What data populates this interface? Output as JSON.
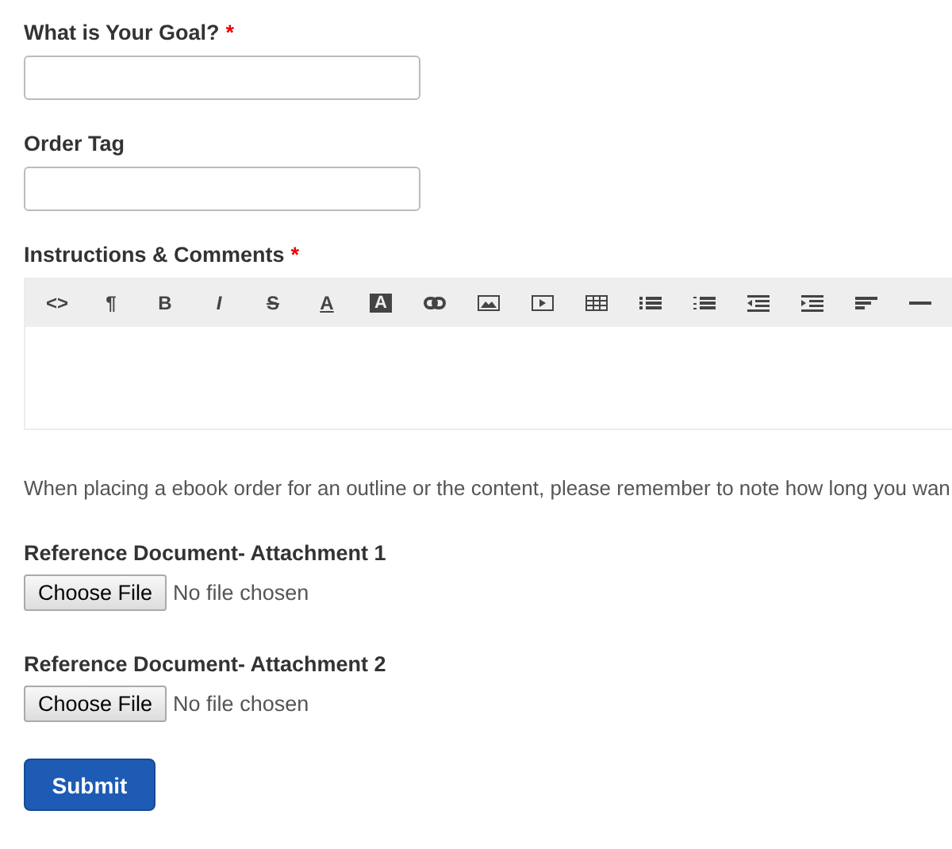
{
  "fields": [
    {
      "label": "What is Your Goal?",
      "required_mark": "*"
    },
    {
      "label": "Order Tag"
    }
  ],
  "editor": {
    "label": "Instructions & Comments",
    "required_mark": "*",
    "tools": [
      {
        "kind": "glyph",
        "text": "<>"
      },
      {
        "kind": "glyph",
        "text": "¶"
      },
      {
        "kind": "bold",
        "text": "B"
      },
      {
        "kind": "italic",
        "text": "I"
      },
      {
        "kind": "strike",
        "text": "S"
      },
      {
        "kind": "underline",
        "text": "A"
      },
      {
        "kind": "inverse",
        "text": "A"
      },
      {
        "kind": "link"
      },
      {
        "kind": "image"
      },
      {
        "kind": "video"
      },
      {
        "kind": "table"
      },
      {
        "kind": "bullets"
      },
      {
        "kind": "numbers"
      },
      {
        "kind": "outdent"
      },
      {
        "kind": "indent"
      },
      {
        "kind": "align"
      },
      {
        "kind": "rule"
      }
    ]
  },
  "note": "When placing a ebook order for an outline or the content, please remember to note how long you wan",
  "attachments": [
    {
      "label": "Reference Document- Attachment 1",
      "button": "Choose File",
      "status": "No file chosen"
    },
    {
      "label": "Reference Document- Attachment 2",
      "button": "Choose File",
      "status": "No file chosen"
    }
  ],
  "submit": "Submit"
}
